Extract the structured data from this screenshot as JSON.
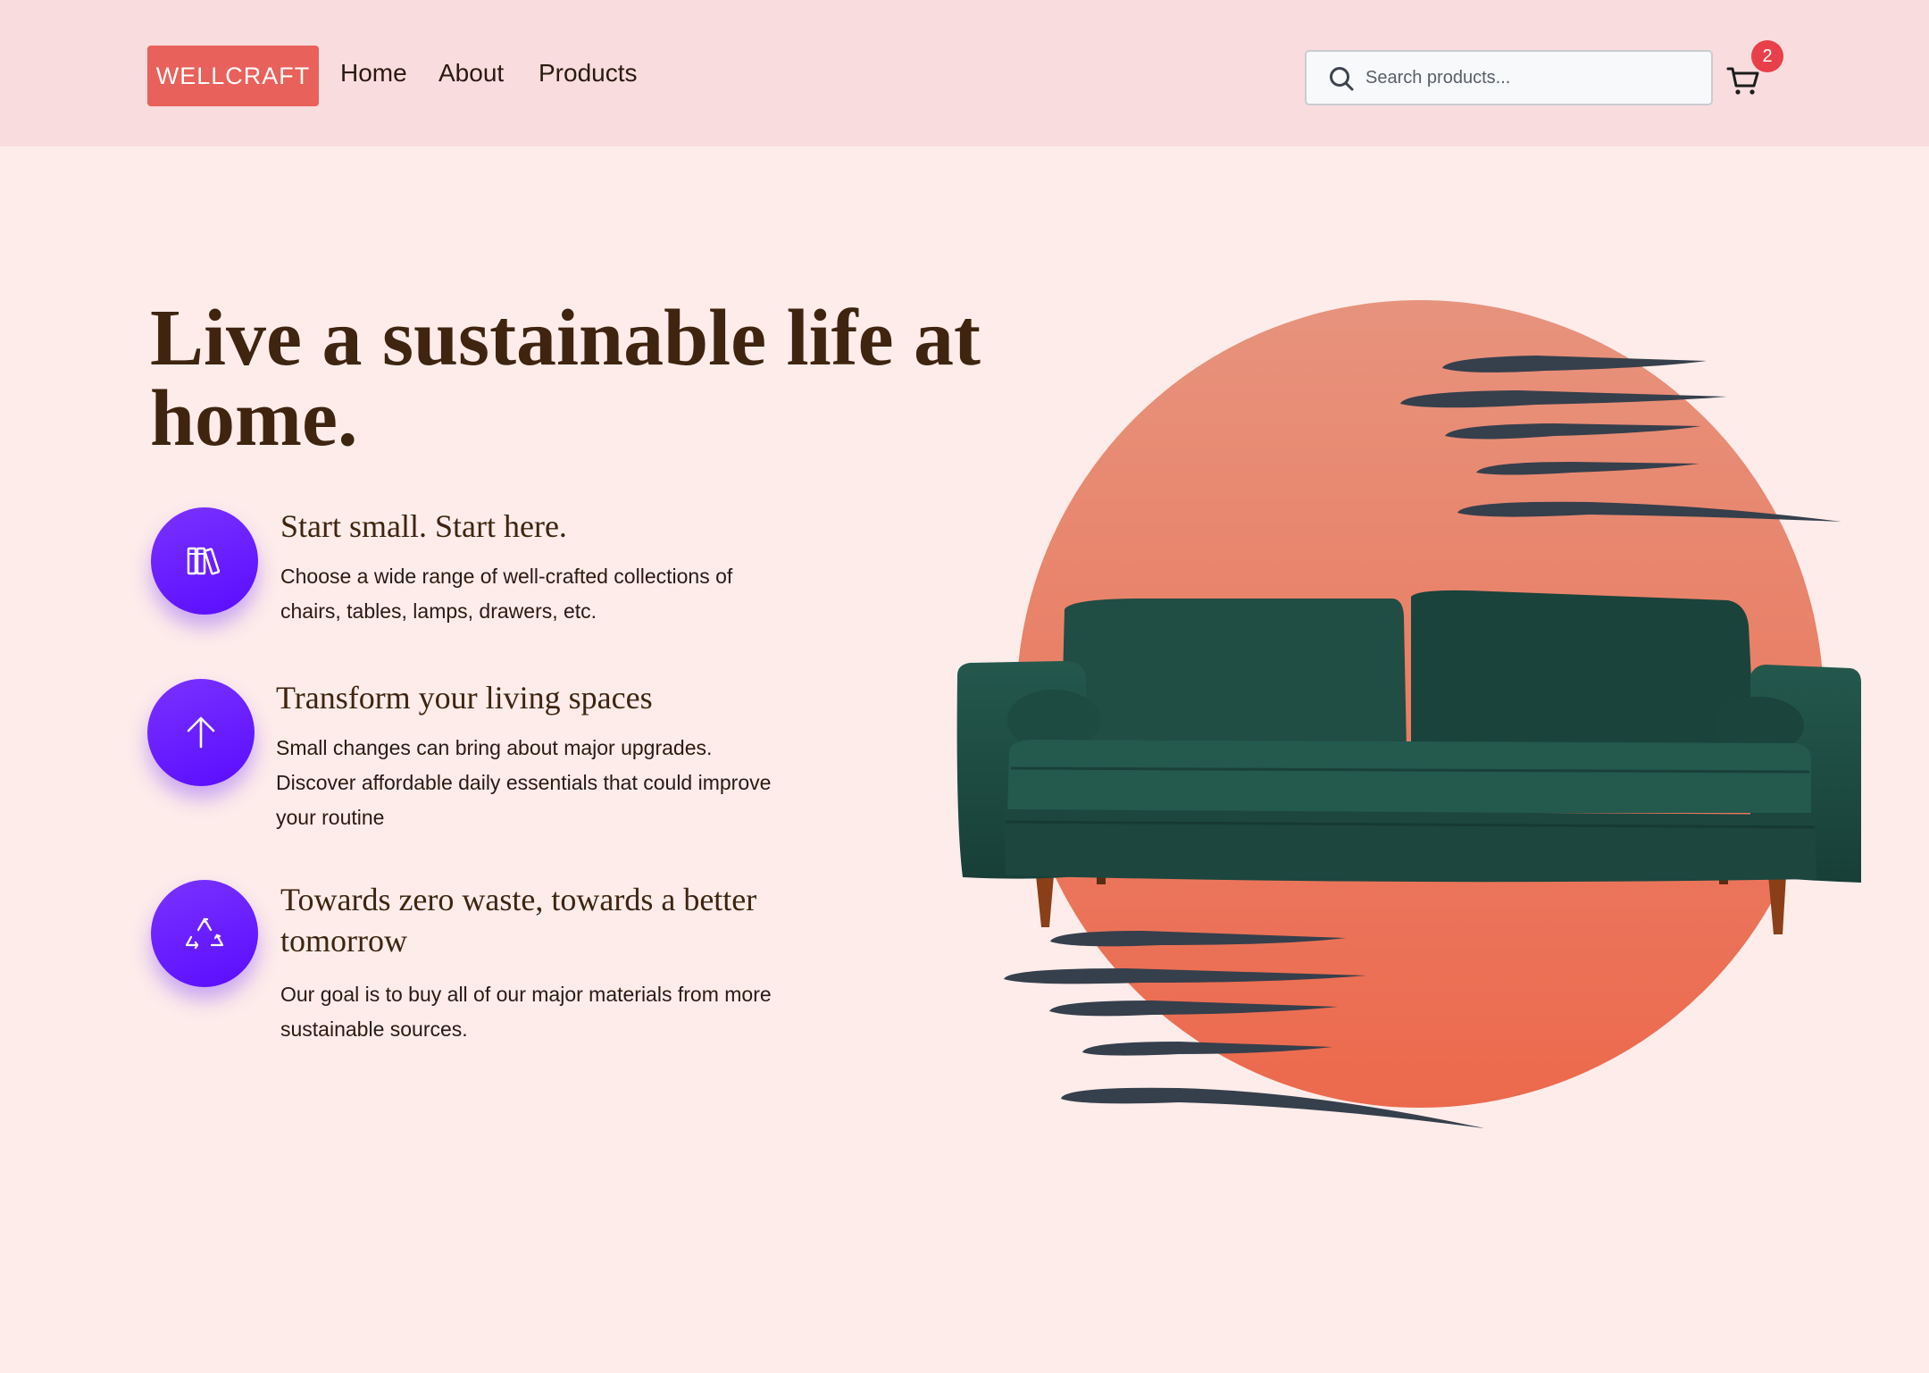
{
  "header": {
    "logo": "WELLCRAFT",
    "nav": [
      "Home",
      "About",
      "Products"
    ],
    "search_placeholder": "Search products...",
    "cart_count": "2"
  },
  "hero": {
    "title": "Live a sustainable life at home."
  },
  "features": [
    {
      "icon": "books-icon",
      "title": "Start small. Start here.",
      "description": "Choose a wide range of well-crafted collections of chairs, tables, lamps, drawers, etc."
    },
    {
      "icon": "arrow-up-icon",
      "title": "Transform your living spaces",
      "description": "Small changes can bring about major upgrades. Discover affordable daily essentials that could improve your routine"
    },
    {
      "icon": "recycle-icon",
      "title": "Towards zero waste, towards a better tomorrow",
      "description": "Our goal is to buy all of our major materials from more sustainable sources."
    }
  ],
  "colors": {
    "page_background": "#fdecea",
    "header_background": "#f9dcde",
    "logo_background": "#e8615a",
    "accent_purple": "#6a1fff",
    "circle_gradient_top": "#e7937d",
    "circle_gradient_bottom": "#ec694d",
    "sofa_green": "#1f4f46",
    "badge_red": "#e8404a"
  }
}
